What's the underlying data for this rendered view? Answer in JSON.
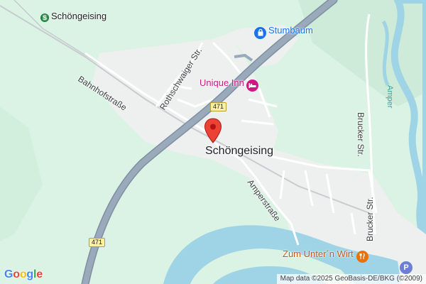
{
  "map": {
    "town": "Schöngeising",
    "station": "Schöngeising",
    "streets": {
      "bahnhof": "Bahnhofstraße",
      "rothschwaiger": "Rothschwaiger Str.",
      "amper": "Amperstraße",
      "brucker": "Brucker Str."
    },
    "river": "Amper",
    "road_number": "471",
    "pois": {
      "stumbaum": "Stumbaum",
      "unique_inn": "Unique Inn",
      "unter_wirt": "Zum Unter´n Wirt"
    },
    "attribution": "Map data ©2025 GeoBasis-DE/BKG (©2009)",
    "logo": [
      "G",
      "o",
      "o",
      "g",
      "l",
      "e"
    ]
  },
  "colors": {
    "land": "#daf3e4",
    "urban": "#eef0ef",
    "water": "#9fd4e6",
    "highway": "#8e9fb2",
    "marker": "#ea4335"
  },
  "icons": {
    "marker": "map-pin-icon",
    "station": "train-station-icon",
    "shopping": "shopping-bag-icon",
    "hotel": "bed-icon",
    "restaurant": "fork-knife-icon",
    "parking": "parking-icon"
  }
}
